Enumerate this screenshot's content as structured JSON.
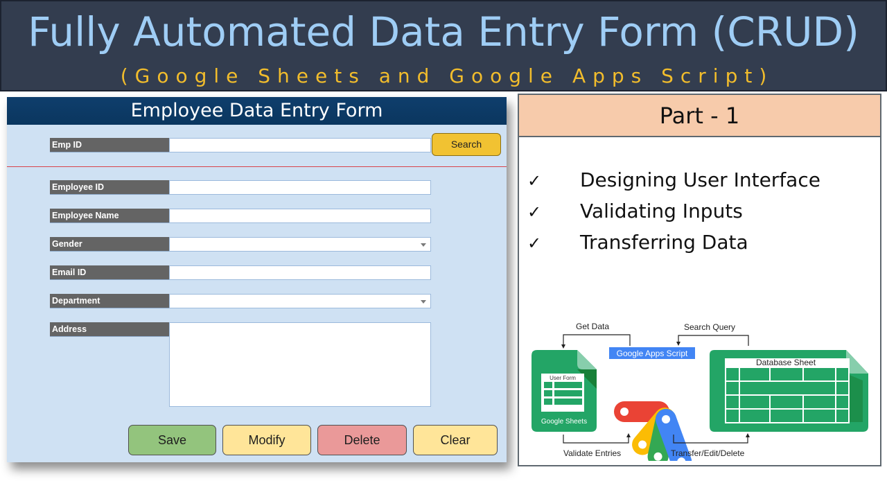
{
  "banner": {
    "title": "Fully Automated Data Entry Form (CRUD)",
    "subtitle": "(Google Sheets and Google Apps Script)"
  },
  "form": {
    "title": "Employee Data Entry Form",
    "search": {
      "label": "Emp ID",
      "value": "",
      "button_label": "Search"
    },
    "fields": [
      {
        "label": "Employee ID",
        "type": "text",
        "value": ""
      },
      {
        "label": "Employee Name",
        "type": "text",
        "value": ""
      },
      {
        "label": "Gender",
        "type": "dropdown",
        "value": ""
      },
      {
        "label": "Email ID",
        "type": "text",
        "value": ""
      },
      {
        "label": "Department",
        "type": "dropdown",
        "value": ""
      },
      {
        "label": "Address",
        "type": "textarea",
        "value": ""
      }
    ],
    "buttons": [
      {
        "label": "Save",
        "color": "#93c47d"
      },
      {
        "label": "Modify",
        "color": "#ffe599"
      },
      {
        "label": "Delete",
        "color": "#ea9999"
      },
      {
        "label": "Clear",
        "color": "#ffe599"
      }
    ]
  },
  "panel": {
    "header": "Part - 1",
    "check_symbol": "✓",
    "items": [
      "Designing User Interface",
      "Validating Inputs",
      "Transferring Data"
    ]
  },
  "diagram": {
    "get_data": "Get Data",
    "search_query": "Search Query",
    "apps_script_label": "Google Apps Script",
    "sheets_inner_label": "User Form",
    "sheets_label": "Google Sheets",
    "database_label": "Database Sheet",
    "validate_entries": "Validate Entries",
    "transfer_edit_delete": "Transfer/Edit/Delete",
    "colors": {
      "sheets_green": "#23a566",
      "sheets_dark_green": "#188038",
      "sheets_fold": "#87ceac",
      "script_blue": "#4285f4",
      "script_green": "#34a853",
      "script_yellow": "#fbbc04",
      "script_red": "#ea4335"
    }
  }
}
